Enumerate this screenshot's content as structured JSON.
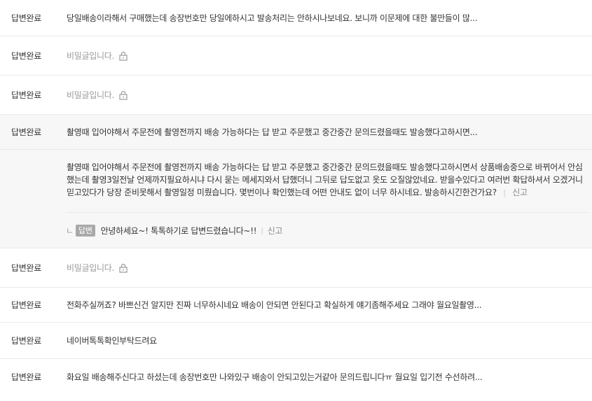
{
  "rows_before": [
    {
      "status": "답변완료",
      "title": "당일배송이라해서 구매했는데 송장번호만 당일에하시고 발송처리는 안하시나보네요. 보니까 이문제에 대한 불만들이 많...",
      "secret": false
    },
    {
      "status": "답변완료",
      "title": "비밀글입니다.",
      "secret": true
    },
    {
      "status": "답변완료",
      "title": "비밀글입니다.",
      "secret": true
    }
  ],
  "expanded": {
    "status": "답변완료",
    "title": "촬영때 입어야해서 주문전에 촬영전까지 배송 가능하다는 답 받고 주문했고 중간중간 문의드렸을때도 발송했다고하시면...",
    "question": "촬영때 입어야해서 주문전에 촬영전까지 배송 가능하다는 답 받고 주문했고 중간중간 문의드렸을때도 발송했다고하시면서 상품배송중으로 바뀌어서 안심했는데 촬영3일전날 언제까지필요하시냐 다시 묻는 메세지와서 답했더니 그뒤로 답도없고 옷도 오질않았네요. 받을수있다고 여러번 확답하셔서 오겠거니 믿고있다가 당장 준비못해서 촬영일정 미뤘습니다. 몇번이나 확인했는데 어떤 안내도 없이 너무 하시네요. 발송하시긴한건가요?",
    "report_label": "신고",
    "reply_arrow": "ㄴ",
    "answer_badge": "답변",
    "answer_text": "안녕하세요~! 톡톡하기로 답변드렸습니다~!!",
    "answer_report_label": "신고"
  },
  "rows_after": [
    {
      "status": "답변완료",
      "title": "비밀글입니다.",
      "secret": true
    },
    {
      "status": "답변완료",
      "title": "전화주실꺼죠? 바쁘신건 알지만 진짜 너무하시네요 배송이 안되면 안된다고 확실하게 얘기좀해주세요 그래야 월요일촬영...",
      "secret": false
    },
    {
      "status": "답변완료",
      "title": "네이버톡톡확인부탁드려요",
      "secret": false
    },
    {
      "status": "답변완료",
      "title": "화요일 배송해주신다고 하셨는데 송장번호만 나와있구 배송이 안되고있는거같아 문의드립니다ㅠ 월요일 입기전 수선하려...",
      "secret": false
    }
  ],
  "icons": {
    "lock": "lock-icon"
  }
}
